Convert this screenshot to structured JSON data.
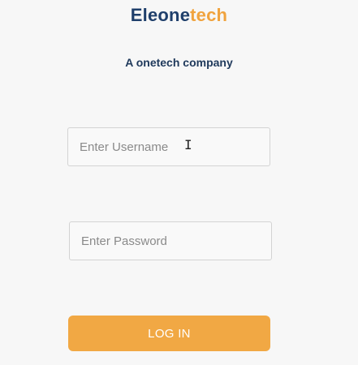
{
  "brand": {
    "name_part1": "Eleone",
    "name_part2": "tech",
    "tagline": "A onetech company",
    "colors": {
      "primary": "#1f3f6b",
      "accent": "#f0a33e"
    }
  },
  "form": {
    "username": {
      "value": "",
      "placeholder": "Enter Username"
    },
    "password": {
      "value": "",
      "placeholder": "Enter Password"
    },
    "login_label": "LOG IN"
  },
  "cursor_icon": "text-cursor-icon"
}
